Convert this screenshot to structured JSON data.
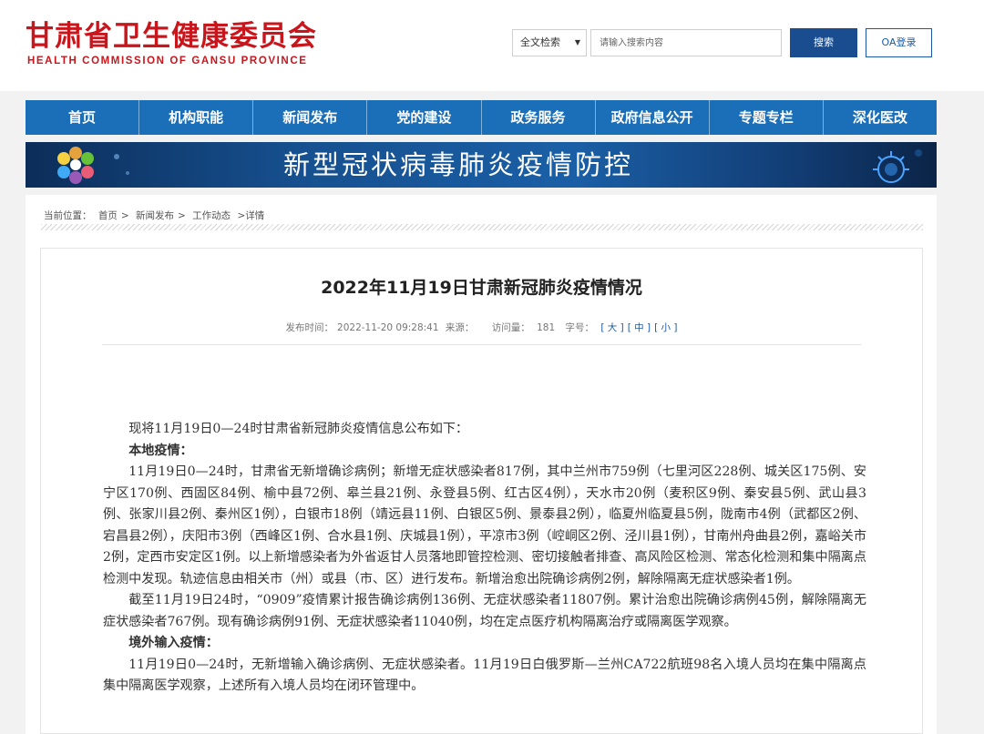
{
  "header": {
    "title_cn": "甘肃省卫生健康委员会",
    "title_en": "HEALTH COMMISSION OF GANSU PROVINCE",
    "search_scope": "全文检索",
    "search_placeholder": "请输入搜索内容",
    "search_button": "搜索",
    "oa_button": "OA登录"
  },
  "nav": {
    "items": [
      "首页",
      "机构职能",
      "新闻发布",
      "党的建设",
      "政务服务",
      "政府信息公开",
      "专题专栏",
      "深化医改"
    ]
  },
  "banner": {
    "title": "新型冠状病毒肺炎疫情防控"
  },
  "breadcrumb": {
    "label": "当前位置：",
    "items": [
      "首页",
      ">",
      "新闻发布",
      ">",
      "工作动态",
      ">详情"
    ]
  },
  "article": {
    "title": "2022年11月19日甘肃新冠肺炎疫情情况",
    "meta": {
      "publish_label": "发布时间：",
      "publish_time": "2022-11-20 09:28:41",
      "source_label": "来源：",
      "views_label": "访问量：",
      "views": "181",
      "fontsize_label": "字号：",
      "large": "[ 大 ]",
      "medium": "[ 中 ]",
      "small": "[ 小 ]"
    },
    "paragraphs": [
      {
        "bold": false,
        "text": "现将11月19日0—24时甘肃省新冠肺炎疫情信息公布如下："
      },
      {
        "bold": true,
        "text": "本地疫情："
      },
      {
        "bold": false,
        "text": "11月19日0—24时，甘肃省无新增确诊病例；新增无症状感染者817例，其中兰州市759例（七里河区228例、城关区175例、安宁区170例、西固区84例、榆中县72例、皋兰县21例、永登县5例、红古区4例），天水市20例（麦积区9例、秦安县5例、武山县3例、张家川县2例、秦州区1例），白银市18例（靖远县11例、白银区5例、景泰县2例），临夏州临夏县5例，陇南市4例（武都区2例、宕昌县2例），庆阳市3例（西峰区1例、合水县1例、庆城县1例），平凉市3例（崆峒区2例、泾川县1例），甘南州舟曲县2例，嘉峪关市2例，定西市安定区1例。以上新增感染者为外省返甘人员落地即管控检测、密切接触者排查、高风险区检测、常态化检测和集中隔离点检测中发现。轨迹信息由相关市（州）或县（市、区）进行发布。新增治愈出院确诊病例2例，解除隔离无症状感染者1例。"
      },
      {
        "bold": false,
        "text": "截至11月19日24时，“0909”疫情累计报告确诊病例136例、无症状感染者11807例。累计治愈出院确诊病例45例，解除隔离无症状感染者767例。现有确诊病例91例、无症状感染者11040例，均在定点医疗机构隔离治疗或隔离医学观察。"
      },
      {
        "bold": true,
        "text": "境外输入疫情："
      },
      {
        "bold": false,
        "text": "11月19日0—24时，无新增输入确诊病例、无症状感染者。11月19日白俄罗斯—兰州CA722航班98名入境人员均在集中隔离点集中隔离医学观察，上述所有入境人员均在闭环管理中。"
      }
    ]
  },
  "colors": {
    "brand_red": "#c8161d",
    "nav_blue": "#1b6fb8",
    "button_blue": "#1a4d8f"
  }
}
